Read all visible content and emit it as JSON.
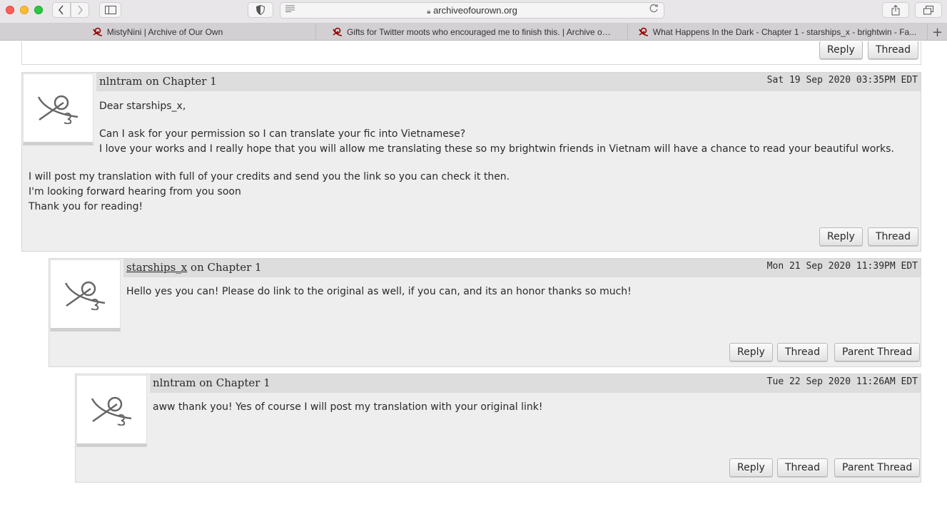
{
  "browser": {
    "url": "archiveofourown.org",
    "tabs": [
      {
        "label": "MistyNini | Archive of Our Own"
      },
      {
        "label": "Gifts for Twitter moots who encouraged me to finish this. | Archive of..."
      },
      {
        "label": "What Happens In the Dark - Chapter 1 - starships_x - brightwin - Fa..."
      }
    ],
    "new_tab_label": "+",
    "icons": {
      "back": "chevron-left-icon",
      "forward": "chevron-right-icon",
      "sidebar": "sidebar-icon",
      "shield": "privacy-shield-icon",
      "reader": "reader-lines-icon",
      "reload": "reload-icon",
      "share": "share-icon",
      "tabs": "tab-overview-icon",
      "favicon": "ao3-logo-icon"
    },
    "colors": {
      "favicon": "#990000",
      "close": "#fe5f57",
      "minimize": "#febc2e",
      "zoom": "#28c840"
    }
  },
  "previous_comment": {
    "reply_label": "Reply",
    "thread_label": "Thread"
  },
  "comments": [
    {
      "author": "nlntram",
      "on_text": " on Chapter 1",
      "datetime": "Sat 19 Sep 2020 03:35PM EDT",
      "paragraphs": [
        "Dear starships_x,",
        "Can I ask for your permission so I can translate your fic into Vietnamese?",
        "I love your works and I really hope that you will allow me translating these so my brightwin friends in Vietnam will have a chance to read your beautiful works.",
        "I will post my translation with full of your credits and send you the link so you can check it then.",
        "I'm looking forward hearing from you soon",
        "Thank you for reading!"
      ],
      "reply_label": "Reply",
      "thread_label": "Thread"
    },
    {
      "author": "starships_x",
      "on_text": " on Chapter 1",
      "datetime": "Mon 21 Sep 2020 11:39PM EDT",
      "paragraphs": [
        "Hello yes you can! Please do link to the original as well, if you can, and its an honor thanks so much!"
      ],
      "reply_label": "Reply",
      "thread_label": "Thread",
      "parent_thread_label": "Parent Thread"
    },
    {
      "author": "nlntram",
      "on_text": " on Chapter 1",
      "datetime": "Tue 22 Sep 2020 11:26AM EDT",
      "paragraphs": [
        "aww thank you! Yes of course I will post my translation with your original link!"
      ],
      "reply_label": "Reply",
      "thread_label": "Thread",
      "parent_thread_label": "Parent Thread"
    }
  ],
  "avatar_icon": "ao3-default-avatar-icon"
}
